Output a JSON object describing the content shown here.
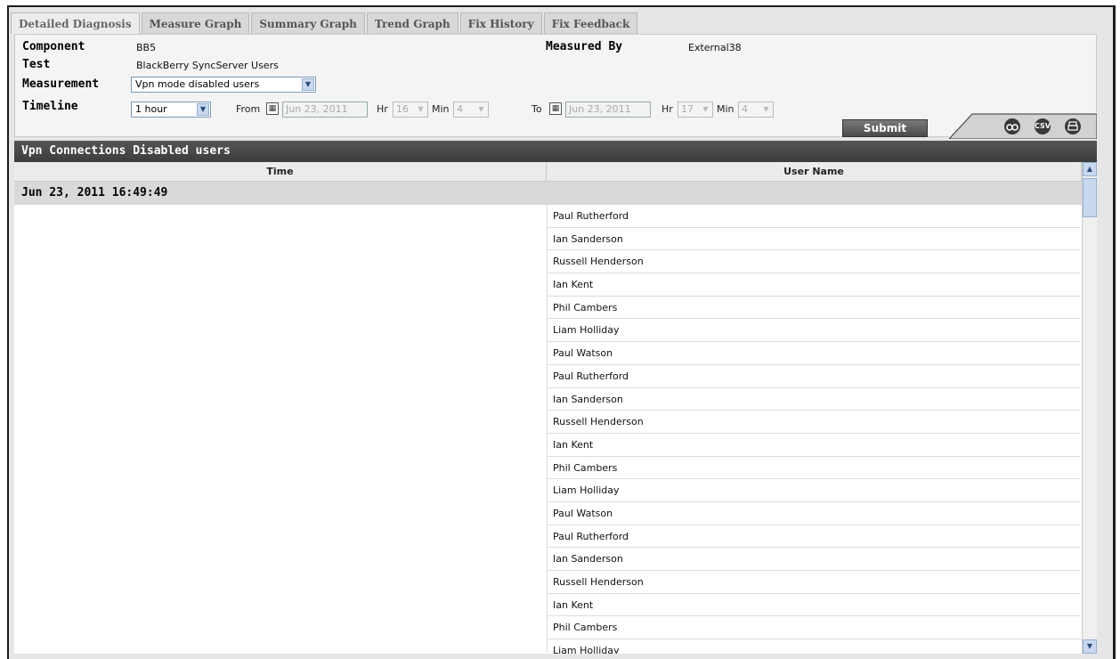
{
  "tabs": [
    "Detailed Diagnosis",
    "Measure Graph",
    "Summary Graph",
    "Trend Graph",
    "Fix History",
    "Fix Feedback"
  ],
  "info": {
    "component_label": "Component",
    "component_value": "BB5",
    "test_label": "Test",
    "test_value": "BlackBerry SyncServer Users",
    "measured_by_label": "Measured By",
    "measured_by_value": "External38",
    "measurement_label": "Measurement",
    "measurement_value": "Vpn mode disabled users",
    "timeline_label": "Timeline",
    "timeline_value": "1 hour"
  },
  "range": {
    "from_label": "From",
    "from_date": "Jun 23, 2011",
    "from_hr_label": "Hr",
    "from_hr": "16",
    "from_min_label": "Min",
    "from_min": "4",
    "to_label": "To",
    "to_date": "Jun 23, 2011",
    "to_hr_label": "Hr",
    "to_hr": "17",
    "to_min_label": "Min",
    "to_min": "4"
  },
  "submit_label": "Submit",
  "toolbar": {
    "search_icon": "binoculars-icon",
    "csv_label": "CSV",
    "print_icon": "printer-icon"
  },
  "section_title": "Vpn Connections Disabled users",
  "table": {
    "col_time": "Time",
    "col_user": "User Name",
    "group_time": "Jun 23, 2011 16:49:49",
    "rows": [
      "Paul Rutherford",
      "Ian Sanderson",
      "Russell Henderson",
      "Ian Kent",
      "Phil Cambers",
      "Liam Holliday",
      "Paul Watson",
      "Paul Rutherford",
      "Ian Sanderson",
      "Russell Henderson",
      "Ian Kent",
      "Phil Cambers",
      "Liam Holliday",
      "Paul Watson",
      "Paul Rutherford",
      "Ian Sanderson",
      "Russell Henderson",
      "Ian Kent",
      "Phil Cambers",
      "Liam Holliday"
    ]
  }
}
